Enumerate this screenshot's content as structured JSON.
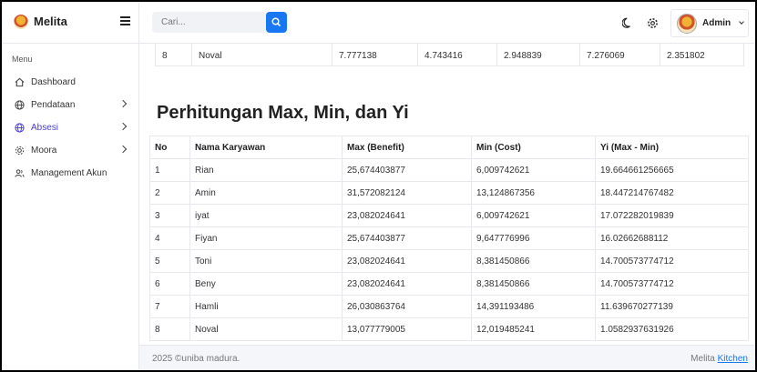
{
  "brand": {
    "name": "Melita"
  },
  "sidebar": {
    "menu_heading": "Menu",
    "items": [
      {
        "label": "Dashboard",
        "icon": "home-icon",
        "has_submenu": false,
        "active": false
      },
      {
        "label": "Pendataan",
        "icon": "globe-icon",
        "has_submenu": true,
        "active": false
      },
      {
        "label": "Absesi",
        "icon": "globe-icon",
        "has_submenu": true,
        "active": true
      },
      {
        "label": "Moora",
        "icon": "settings-icon",
        "has_submenu": true,
        "active": false
      },
      {
        "label": "Management Akun",
        "icon": "users-icon",
        "has_submenu": false,
        "active": false
      }
    ]
  },
  "topbar": {
    "search_placeholder": "Cari...",
    "user_name": "Admin"
  },
  "previous_table_row": [
    "8",
    "Noval",
    "7.777138",
    "4.743416",
    "2.948839",
    "7.276069",
    "2.351802"
  ],
  "section_title": "Perhitungan Max, Min, dan Yi",
  "table": {
    "headers": [
      "No",
      "Nama Karyawan",
      "Max (Benefit)",
      "Min (Cost)",
      "Yi (Max - Min)"
    ],
    "rows": [
      [
        "1",
        "Rian",
        "25,674403877",
        "6,009742621",
        "19.664661256665"
      ],
      [
        "2",
        "Amin",
        "31,572082124",
        "13,124867356",
        "18.447214767482"
      ],
      [
        "3",
        "iyat",
        "23,082024641",
        "6,009742621",
        "17.072282019839"
      ],
      [
        "4",
        "Fiyan",
        "25,674403877",
        "9,647776996",
        "16.02662688112"
      ],
      [
        "5",
        "Toni",
        "23,082024641",
        "8,381450866",
        "14.700573774712"
      ],
      [
        "6",
        "Beny",
        "23,082024641",
        "8,381450866",
        "14.700573774712"
      ],
      [
        "7",
        "Hamli",
        "26,030863764",
        "14,391193486",
        "11.639670277139"
      ],
      [
        "8",
        "Noval",
        "13,077779005",
        "12,019485241",
        "1.0582937631926"
      ]
    ]
  },
  "footer": {
    "copyright": "2025 ©uniba madura.",
    "credit_prefix": "Melita",
    "credit_link": "Kitchen"
  },
  "colors": {
    "accent": "#1877f2",
    "active_nav": "#4a3fd0"
  }
}
